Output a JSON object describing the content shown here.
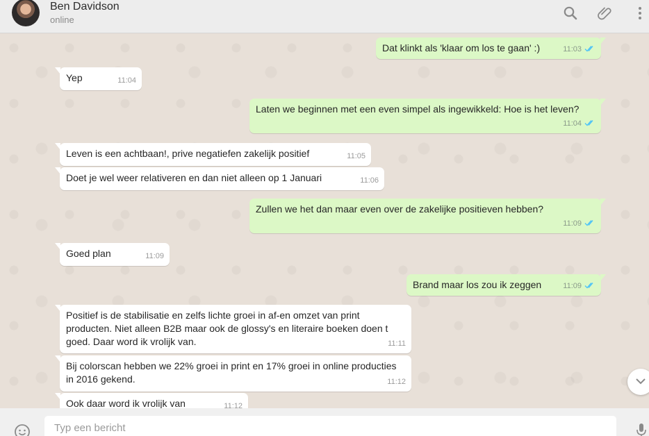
{
  "header": {
    "name": "Ben Davidson",
    "status": "online",
    "icons": [
      "search-icon",
      "attach-icon",
      "menu-icon"
    ]
  },
  "colors": {
    "chat_bg": "#e5ddd5",
    "incoming": "#ffffff",
    "outgoing": "#dcf8c6",
    "tick_read": "#4fc3f7"
  },
  "messages": [
    {
      "dir": "out",
      "text": "Dat klinkt als 'klaar om los te gaan' :)",
      "time": "11:03",
      "read": true
    },
    {
      "dir": "in",
      "text": "Yep",
      "time": "11:04"
    },
    {
      "dir": "out",
      "text": "Laten we beginnen met een even simpel als ingewikkeld: Hoe is het leven?",
      "time": "11:04",
      "read": true
    },
    {
      "dir": "in",
      "text": "Leven is een achtbaan!, prive negatiefen zakelijk positief",
      "time": "11:05"
    },
    {
      "dir": "in",
      "text": "Doet je wel weer relativeren en dan niet alleen op 1 Januari",
      "time": "11:06"
    },
    {
      "dir": "out",
      "text": "Zullen we het dan maar even over de zakelijke positieven hebben?",
      "time": "11:09",
      "read": true
    },
    {
      "dir": "in",
      "text": "Goed plan",
      "time": "11:09"
    },
    {
      "dir": "out",
      "text": "Brand maar los zou ik zeggen",
      "time": "11:09",
      "read": true
    },
    {
      "dir": "in",
      "text": "Positief is de stabilisatie en zelfs lichte groei in af-en omzet van print producten. Niet alleen B2B maar ook de glossy's en literaire boeken doen t goed. Daar word ik vrolijk van.",
      "time": "11:11"
    },
    {
      "dir": "in",
      "text": "Bij colorscan hebben we 22% groei in print en 17% groei in online producties in 2016 gekend.",
      "time": "11:12"
    },
    {
      "dir": "in",
      "text": "Ook daar word ik vrolijk van",
      "time": "11:12"
    }
  ],
  "composer": {
    "placeholder": "Typ een bericht",
    "icons": [
      "emoji-icon",
      "microphone-icon"
    ]
  }
}
